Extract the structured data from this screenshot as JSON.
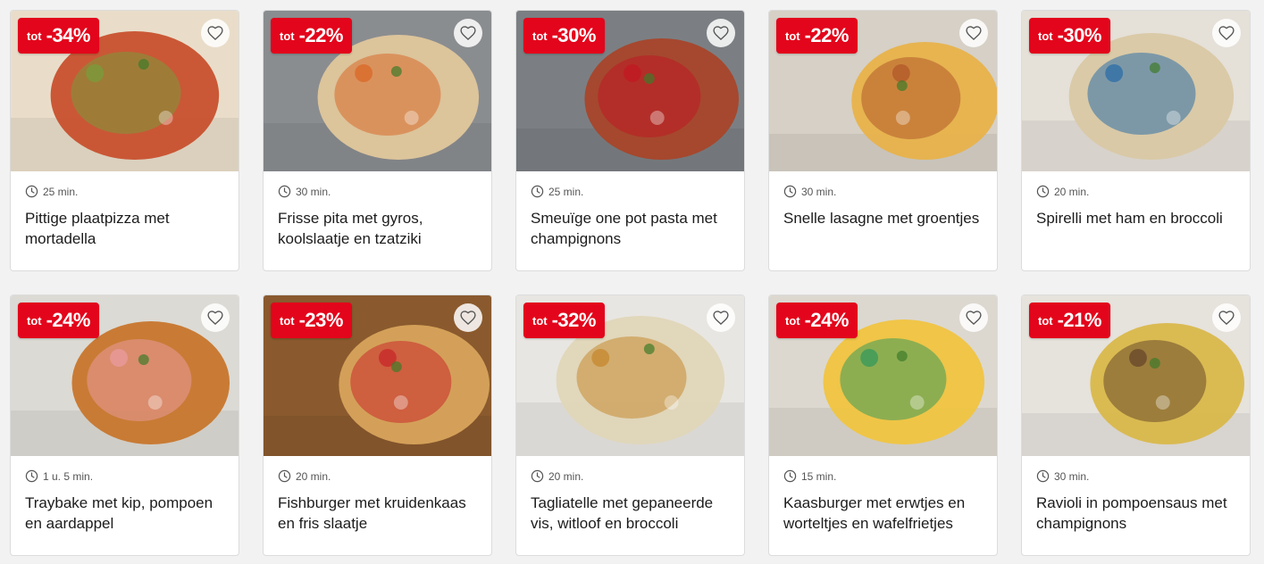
{
  "discount_prefix": "tot",
  "colors": {
    "badge": "#e3051b",
    "card": "#ffffff",
    "page": "#f2f2f2"
  },
  "icons": {
    "favorite": "heart-outline-icon",
    "time": "clock-icon"
  },
  "recipes": [
    {
      "discount": "-34%",
      "time": "25 min.",
      "title": "Pittige plaatpizza met mortadella",
      "palette": [
        "#e9ddc9",
        "#c8502e",
        "#7a9a3a"
      ]
    },
    {
      "discount": "-22%",
      "time": "30 min.",
      "title": "Frisse pita met gyros, koolslaatje en tzatziki",
      "palette": [
        "#8a8d90",
        "#e0c79c",
        "#d96a2a"
      ]
    },
    {
      "discount": "-30%",
      "time": "25 min.",
      "title": "Smeuïge one pot pasta met champignons",
      "palette": [
        "#7b7f83",
        "#a8462a",
        "#c01a22"
      ]
    },
    {
      "discount": "-22%",
      "time": "30 min.",
      "title": "Snelle lasagne met groentjes",
      "palette": [
        "#d6d0c6",
        "#e8b24a",
        "#b35a2a"
      ]
    },
    {
      "discount": "-30%",
      "time": "20 min.",
      "title": "Spirelli met ham en broccoli",
      "palette": [
        "#e5e0d8",
        "#d9c8a4",
        "#2f6fa8"
      ]
    },
    {
      "discount": "-24%",
      "time": "1 u. 5 min.",
      "title": "Traybake met kip, pompoen en aardappel",
      "palette": [
        "#dcdad4",
        "#c7762c",
        "#e89a9a"
      ]
    },
    {
      "discount": "-23%",
      "time": "20 min.",
      "title": "Fishburger met kruidenkaas en fris slaatje",
      "palette": [
        "#8a5a2e",
        "#d8a45c",
        "#c82a2a"
      ]
    },
    {
      "discount": "-32%",
      "time": "20 min.",
      "title": "Tagliatelle met gepaneerde vis, witloof en broccoli",
      "palette": [
        "#e8e6e2",
        "#e0d6b8",
        "#c78a32"
      ]
    },
    {
      "discount": "-24%",
      "time": "15 min.",
      "title": "Kaasburger met erwtjes en worteltjes en wafelfrietjes",
      "palette": [
        "#dcd8d0",
        "#f0c440",
        "#3a9a5a"
      ]
    },
    {
      "discount": "-21%",
      "time": "30 min.",
      "title": "Ravioli in pompoensaus met champignons",
      "palette": [
        "#e6e2dc",
        "#d9b84a",
        "#6a4a2a"
      ]
    }
  ]
}
